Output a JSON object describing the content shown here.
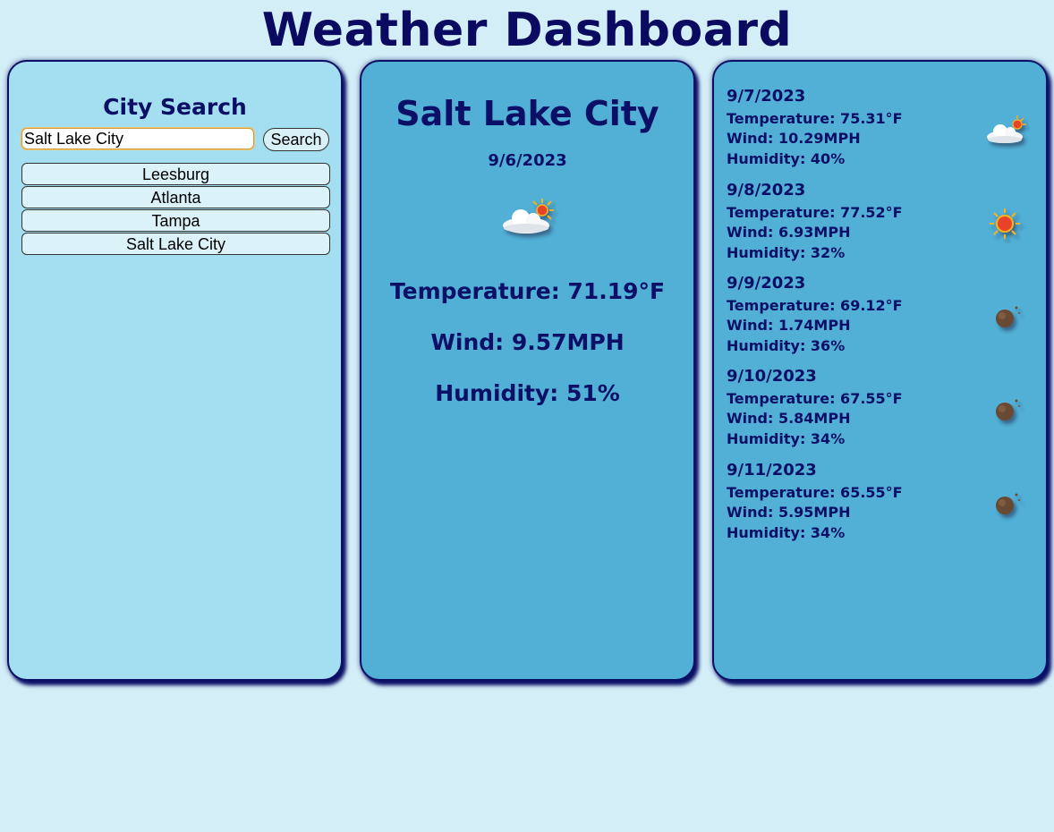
{
  "header": {
    "title": "Weather Dashboard"
  },
  "search": {
    "heading": "City Search",
    "input_value": "Salt Lake City",
    "button_label": "Search",
    "history": [
      "Leesburg",
      "Atlanta",
      "Tampa",
      "Salt Lake City"
    ]
  },
  "current": {
    "city": "Salt Lake City",
    "date": "9/6/2023",
    "icon": "partly-cloudy-icon",
    "temperature": "Temperature: 71.19°F",
    "wind": "Wind: 9.57MPH",
    "humidity": "Humidity: 51%"
  },
  "forecast": [
    {
      "date": "9/7/2023",
      "temperature": "Temperature: 75.31°F",
      "wind": "Wind: 10.29MPH",
      "humidity": "Humidity: 40%",
      "icon": "partly-cloudy-icon"
    },
    {
      "date": "9/8/2023",
      "temperature": "Temperature: 77.52°F",
      "wind": "Wind: 6.93MPH",
      "humidity": "Humidity: 32%",
      "icon": "sun-icon"
    },
    {
      "date": "9/9/2023",
      "temperature": "Temperature: 69.12°F",
      "wind": "Wind: 1.74MPH",
      "humidity": "Humidity: 36%",
      "icon": "night-icon"
    },
    {
      "date": "9/10/2023",
      "temperature": "Temperature: 67.55°F",
      "wind": "Wind: 5.84MPH",
      "humidity": "Humidity: 34%",
      "icon": "night-icon"
    },
    {
      "date": "9/11/2023",
      "temperature": "Temperature: 65.55°F",
      "wind": "Wind: 5.95MPH",
      "humidity": "Humidity: 34%",
      "icon": "night-icon"
    }
  ],
  "colors": {
    "title": "#0b0a61",
    "text": "#0b0f66",
    "page_background": "#d3eef7",
    "search_panel": "#a3dff0",
    "weather_panel": "#52b0d6"
  }
}
